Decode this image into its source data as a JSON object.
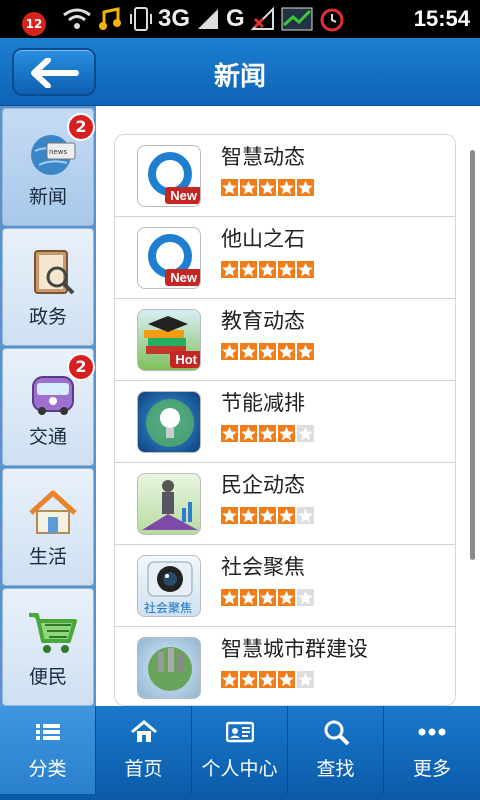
{
  "status_bar": {
    "notification_count": "12",
    "network": "3G",
    "network2": "G",
    "time": "15:54"
  },
  "header": {
    "title": "新闻"
  },
  "sidebar": {
    "items": [
      {
        "label": "新闻",
        "badge": "2",
        "icon": "globe-news-icon"
      },
      {
        "label": "政务",
        "badge": "",
        "icon": "document-search-icon"
      },
      {
        "label": "交通",
        "badge": "2",
        "icon": "bus-icon"
      },
      {
        "label": "生活",
        "badge": "",
        "icon": "house-icon"
      },
      {
        "label": "便民",
        "badge": "",
        "icon": "shopping-cart-icon"
      }
    ]
  },
  "news_list": [
    {
      "title": "智慧动态",
      "tag": "New",
      "rating": 5,
      "icon": "q-logo-icon"
    },
    {
      "title": "他山之石",
      "tag": "New",
      "rating": 5,
      "icon": "q-logo-icon"
    },
    {
      "title": "教育动态",
      "tag": "Hot",
      "rating": 5,
      "icon": "books-icon"
    },
    {
      "title": "节能减排",
      "tag": "",
      "rating": 4,
      "icon": "lightbulb-globe-icon"
    },
    {
      "title": "民企动态",
      "tag": "",
      "rating": 4,
      "icon": "businessman-icon"
    },
    {
      "title": "社会聚焦",
      "tag": "",
      "rating": 4,
      "icon": "camera-lens-icon"
    },
    {
      "title": "智慧城市群建设",
      "tag": "",
      "rating": 4,
      "icon": "city-globe-icon"
    }
  ],
  "tabs": [
    {
      "label": "分类",
      "icon": "list-icon"
    },
    {
      "label": "首页",
      "icon": "home-icon"
    },
    {
      "label": "个人中心",
      "icon": "id-card-icon"
    },
    {
      "label": "查找",
      "icon": "search-icon"
    },
    {
      "label": "更多",
      "icon": "more-icon"
    }
  ],
  "colors": {
    "brand_blue": "#1a78cc",
    "star_orange": "#f07d1a",
    "badge_red": "#d81e1e"
  }
}
